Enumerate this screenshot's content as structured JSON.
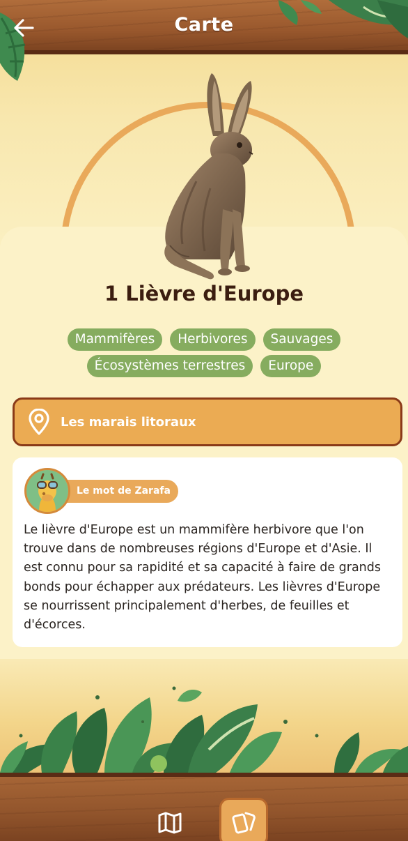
{
  "header": {
    "title": "Carte",
    "back_icon": "arrow-left-icon"
  },
  "animal": {
    "title": "1 Lièvre d'Europe",
    "tags": [
      "Mammifères",
      "Herbivores",
      "Sauvages",
      "Écosystèmes terrestres",
      "Europe"
    ]
  },
  "location": {
    "icon": "map-pin-icon",
    "label": "Les marais litoraux"
  },
  "quote": {
    "badge": "Le mot de Zarafa",
    "avatar": "giraffe-mascot-avatar",
    "text": "Le lièvre d'Europe est un mammifère herbivore que l'on trouve dans de nombreuses régions d'Europe et d'Asie. Il est connu pour sa rapidité et sa capacité à faire de grands bonds pour échapper aux prédateurs. Les lièvres d'Europe se nourrissent principalement d'herbes, de feuilles et d'écorces."
  },
  "bottom_nav": {
    "items": [
      {
        "icon": "map-icon",
        "active": false
      },
      {
        "icon": "cards-icon",
        "active": true
      }
    ]
  },
  "colors": {
    "accent": "#e9a95a",
    "tag": "#86ac5f",
    "wood": "#99582d",
    "wood_dark": "#5a2c15",
    "card": "#fcf2c8"
  }
}
